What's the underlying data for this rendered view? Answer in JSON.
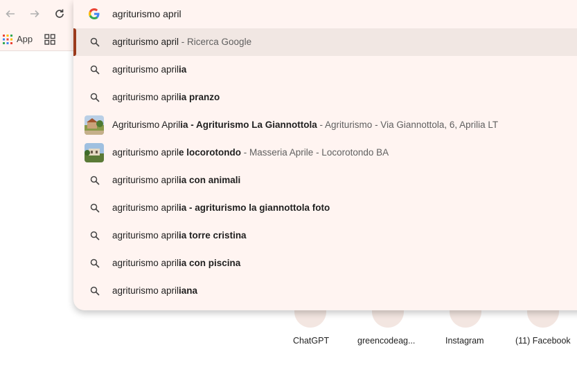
{
  "toolbar": {
    "back_icon": "arrow-left-icon",
    "forward_icon": "arrow-right-icon",
    "reload_icon": "reload-icon"
  },
  "bookmarks_bar": {
    "apps_label": "App"
  },
  "omnibox": {
    "input_value": "agriturismo april",
    "logo": "google-g-icon"
  },
  "suggestions": [
    {
      "type": "search",
      "prefix": "agriturismo april",
      "bold": "",
      "sub": " - Ricerca Google",
      "selected": true
    },
    {
      "type": "search",
      "prefix": "agriturismo april",
      "bold": "ia",
      "sub": ""
    },
    {
      "type": "search",
      "prefix": "agriturismo april",
      "bold": "ia pranzo",
      "sub": ""
    },
    {
      "type": "entity",
      "prefix": "Agriturismo April",
      "bold": "ia - Agriturismo La Giannottola",
      "sub": " - Agriturismo - Via Giannottola, 6, Aprilia LT"
    },
    {
      "type": "entity",
      "prefix": "agriturismo april",
      "bold": "e locorotondo",
      "sub": " - Masseria Aprile - Locorotondo BA"
    },
    {
      "type": "search",
      "prefix": "agriturismo april",
      "bold": "ia con animali",
      "sub": ""
    },
    {
      "type": "search",
      "prefix": "agriturismo april",
      "bold": "ia - agriturismo la giannottola foto",
      "sub": ""
    },
    {
      "type": "search",
      "prefix": "agriturismo april",
      "bold": "ia torre cristina",
      "sub": ""
    },
    {
      "type": "search",
      "prefix": "agriturismo april",
      "bold": "ia con piscina",
      "sub": ""
    },
    {
      "type": "search",
      "prefix": "agriturismo april",
      "bold": "iana",
      "sub": ""
    }
  ],
  "shortcuts": [
    {
      "label": "ChatGPT"
    },
    {
      "label": "greencodeag..."
    },
    {
      "label": "Instagram"
    },
    {
      "label": "(11) Facebook"
    }
  ],
  "colors": {
    "surface": "#fff4f1",
    "selected_row": "#f1e7e3",
    "accent": "#9b3a1c"
  }
}
